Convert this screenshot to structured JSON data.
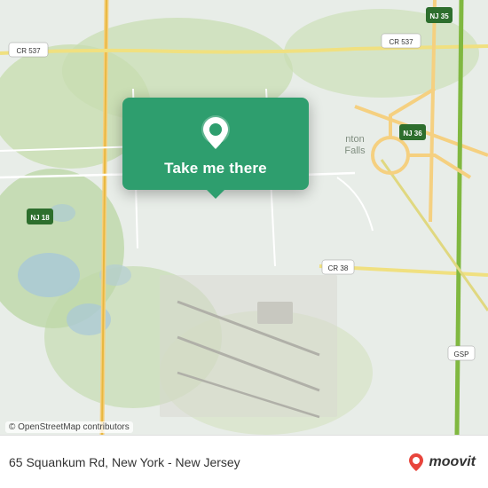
{
  "map": {
    "attribution": "© OpenStreetMap contributors",
    "background_color": "#e8f0e8"
  },
  "popup": {
    "button_label": "Take me there",
    "pin_color": "#ffffff"
  },
  "bottom_bar": {
    "address": "65 Squankum Rd, New York - New Jersey",
    "logo_text": "moovit"
  }
}
